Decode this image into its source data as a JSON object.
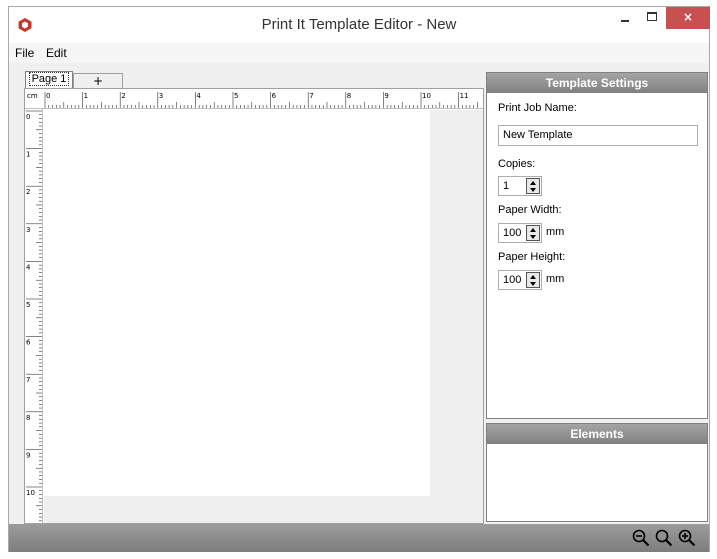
{
  "window": {
    "title": "Print It Template Editor - New",
    "accent_color": "#c0392b",
    "close_label": "×",
    "icons": {
      "app": "app-logo-icon",
      "minimize": "minimize-icon",
      "maximize": "maximize-icon"
    }
  },
  "menu": {
    "file": "File",
    "edit": "Edit"
  },
  "tabs": {
    "page1": "Page 1",
    "add": "+"
  },
  "ruler": {
    "unit": "cm",
    "top_labels": [
      "0",
      "1",
      "2",
      "3",
      "4",
      "5",
      "6",
      "7",
      "8",
      "9",
      "10",
      "11"
    ],
    "left_labels": [
      "0",
      "1",
      "2",
      "3",
      "4",
      "5",
      "6",
      "7",
      "8",
      "9",
      "10"
    ]
  },
  "settings": {
    "header": "Template Settings",
    "print_job_name_label": "Print Job Name:",
    "print_job_name_value": "New Template",
    "copies_label": "Copies:",
    "copies_value": "1",
    "paper_width_label": "Paper Width:",
    "paper_width_value": "100",
    "paper_width_unit": "mm",
    "paper_height_label": "Paper Height:",
    "paper_height_value": "100",
    "paper_height_unit": "mm"
  },
  "elements": {
    "header": "Elements"
  },
  "status": {
    "zoom_icons": [
      "zoom-out-icon",
      "zoom-reset-icon",
      "zoom-in-icon"
    ]
  }
}
